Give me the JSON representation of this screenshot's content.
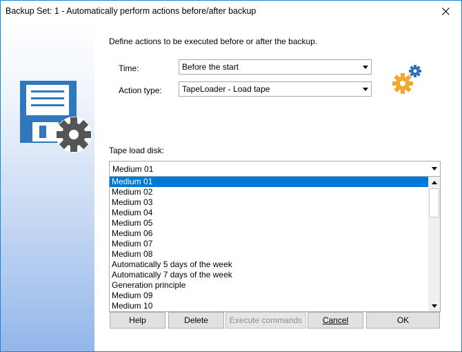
{
  "window": {
    "title": "Backup Set: 1 - Automatically perform actions before/after backup",
    "close_icon": "close-icon"
  },
  "left_panel": {
    "icon": "floppy-disk-gear-icon",
    "colors": {
      "disk": "#2f78be",
      "gear": "#555555"
    }
  },
  "main": {
    "description": "Define actions to be executed before or after the backup.",
    "time": {
      "label": "Time:",
      "value": "Before the start"
    },
    "action_type": {
      "label": "Action type:",
      "value": "TapeLoader - Load tape"
    },
    "gears_icon": "settings-gears-icon",
    "tape_load_disk": {
      "label": "Tape load disk:",
      "value": "Medium 01",
      "options": [
        "Medium 01",
        "Medium 02",
        "Medium 03",
        "Medium 04",
        "Medium 05",
        "Medium 06",
        "Medium 07",
        "Medium 08",
        "Automatically 5 days of the week",
        "Automatically 7 days of the week",
        "Generation principle",
        "Medium 09",
        "Medium 10"
      ],
      "selected_index": 0
    }
  },
  "buttons": {
    "help": "Help",
    "delete": "Delete",
    "execute": "Execute commands",
    "cancel": "Cancel",
    "ok": "OK"
  },
  "colors": {
    "accent": "#0078d7",
    "window_border": "#1883d7"
  }
}
